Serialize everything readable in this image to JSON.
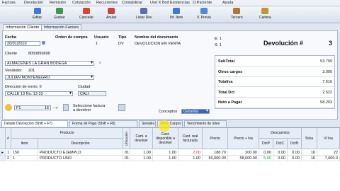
{
  "menu": [
    "Factura",
    "Devolución",
    "Remisión",
    "Cotización",
    "Recurrentes",
    "Contabilizar",
    "Und X Bod",
    "Existencias",
    "O.Paciente",
    "Ayuda"
  ],
  "toolbar": {
    "items": [
      {
        "label": "Editar",
        "icon": "edit-icon",
        "color": "#3d7ad6"
      },
      {
        "label": "Grabar",
        "icon": "save-icon",
        "color": "#3b9a4a"
      },
      {
        "label": "Cancelar",
        "icon": "cancel-icon",
        "color": "#d9443a"
      },
      {
        "label": "Anular",
        "icon": "void-icon",
        "color": "#c8433a"
      },
      {
        "label": "Listar Dev",
        "icon": "list-icon",
        "color": "#5a6fa8"
      },
      {
        "label": "Inf. Item",
        "icon": "info-icon",
        "color": "#3d7ad6"
      },
      {
        "label": "V. Previa",
        "icon": "preview-icon",
        "color": "#4c8bd8"
      },
      {
        "label": "Tercero",
        "icon": "person-icon",
        "color": "#b0782f"
      },
      {
        "label": "Cartera",
        "icon": "wallet-icon",
        "color": "#c0962f"
      }
    ]
  },
  "tabs": [
    "Información Cliente",
    "Información Factura"
  ],
  "header": {
    "fecha_label": "Fecha",
    "fecha": "20/01/2010",
    "orden_label": "Orden de compra",
    "usuario_label": "Usuario",
    "usuario": "1",
    "tipo_label": "Tipo",
    "tipo": "DV",
    "nombre_label": "Nombre del documento",
    "nombre": "DEVOLUCION EN VENTA",
    "e_label": "E: 1",
    "s_label": "S: 1",
    "doc_title": "Devolución #",
    "doc_number": "3"
  },
  "cliente": {
    "label": "Cliente",
    "nit": "8050899898",
    "name": "ALMACENES LA GRAN BODEGA",
    "vendedor_label": "Vendedor",
    "vendedor_code": "201",
    "vendedor": "JULIAN MONTENEGRO",
    "dir_label": "Dirección de envío: 0",
    "dir": "CALLE 13 No. 13-22",
    "ciudad_label": "Ciudad",
    "ciudad": "CALI"
  },
  "selector": {
    "code": "F1",
    "num": "16",
    "text": "Seleccione factura a devolver",
    "arrow": "-->"
  },
  "conceptos": {
    "label": "Conceptos",
    "value": "Garantia"
  },
  "totals": [
    {
      "k": "SubTotal",
      "v": "53.709"
    },
    {
      "k": "Otros cargos",
      "v": "3.000"
    },
    {
      "k": "Totaliva",
      "v": "7.616"
    },
    {
      "k": "Total Dct",
      "v": "2.522"
    },
    {
      "k": "Neto a Pagar",
      "v": "58.203"
    }
  ],
  "grid_tabs": [
    "Detalle Devolución (Shift + F7)",
    "Forma de Pago (Shift + F8)",
    "Seriales",
    "Otros Cargos",
    "Vencimiento de lotes"
  ],
  "grid": {
    "headers": {
      "hash": "#",
      "producto": "Producto",
      "item": "Item",
      "descripcion": "Descripción",
      "ubic": "Ubicación",
      "cant_dev": "Cant. a devolver",
      "cant_disp": "Cant. disponible a devolver",
      "cant_fact": "Cant. real facturada",
      "precio": "Precio",
      "precio_iva": "Precio + Iva",
      "descuentos": "Descuentos",
      "dctp": "DctP",
      "dctc": "DctC",
      "dctn": "DctN",
      "piva": "%Iva",
      "vliva": "Vl Iva"
    },
    "rows": [
      {
        "n": "1",
        "item": "150",
        "desc": "PRODUCTO EJEMPLO",
        "ubic": "01",
        "dev": "1.00",
        "disp": "1.00",
        "fact": "2.00",
        "precio": "188.70",
        "piva": "200.00",
        "dctp": "0.00",
        "dctc": "0.00",
        "dctn": "0.00",
        "iva": "16",
        "vliva": "22"
      },
      {
        "n": "2",
        "item": "1",
        "desc": "PRODUCTO UNO",
        "ubic": "01",
        "dev": "1.00",
        "disp": "1.00",
        "fact": "1.00",
        "precio": "50,000.00",
        "piva": "58,000.00",
        "dctp": "5.00",
        "dctc": "0.00",
        "dctn": "0.00",
        "iva": "16",
        "vliva": "7,600.0"
      }
    ]
  }
}
